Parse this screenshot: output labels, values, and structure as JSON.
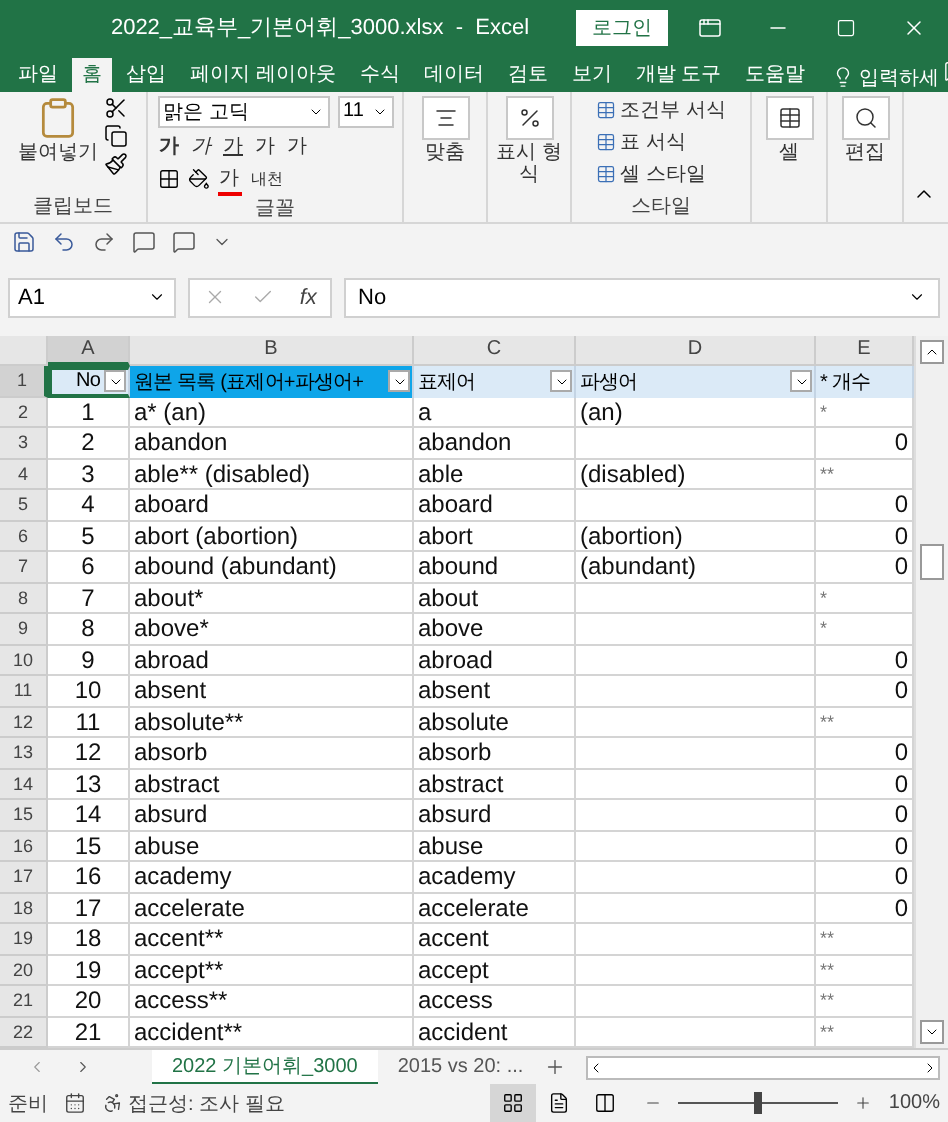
{
  "window": {
    "title": "2022_교육부_기본어휘_3000.xlsx  -  Excel",
    "login_button": "로그인"
  },
  "ribbon_tabs": [
    {
      "label": "파일",
      "selected": false
    },
    {
      "label": "홈",
      "selected": true
    },
    {
      "label": "삽입",
      "selected": false
    },
    {
      "label": "페이지 레이아웃",
      "selected": false
    },
    {
      "label": "수식",
      "selected": false
    },
    {
      "label": "데이터",
      "selected": false
    },
    {
      "label": "검토",
      "selected": false
    },
    {
      "label": "보기",
      "selected": false
    },
    {
      "label": "개발 도구",
      "selected": false
    },
    {
      "label": "도움말",
      "selected": false
    }
  ],
  "tell_me": "입력하세",
  "ribbon": {
    "paste": "붙여넣기",
    "clipboard_group": "클립보드",
    "font_name": "맑은 고딕",
    "font_size": "11",
    "style_buttons": [
      "가",
      "가",
      "가"
    ],
    "size_buttons": [
      "가",
      "가"
    ],
    "font_color": "가",
    "phonetic": "내천",
    "font_group": "글꼴",
    "alignment": "맞춤",
    "number_format": "표시 형식",
    "styles": [
      "조건부 서식",
      "표 서식",
      "셀 스타일"
    ],
    "styles_group": "스타일",
    "cells": "셀",
    "editing": "편집"
  },
  "formula_bar": {
    "name_box": "A1",
    "fx": "fx",
    "value": "No"
  },
  "columns": [
    {
      "letter": "A",
      "selected": true
    },
    {
      "letter": "B",
      "selected": false
    },
    {
      "letter": "C",
      "selected": false
    },
    {
      "letter": "D",
      "selected": false
    },
    {
      "letter": "E",
      "selected": false
    }
  ],
  "header_row": {
    "row": "1",
    "selected": true,
    "cells": [
      {
        "text": "No",
        "highlighted": false,
        "active": true
      },
      {
        "text": "원본 목록 (표제어+파생어+",
        "highlighted": true,
        "active": false
      },
      {
        "text": "표제어",
        "highlighted": false,
        "active": false
      },
      {
        "text": "파생어",
        "highlighted": false,
        "active": false
      },
      {
        "text": "* 개수",
        "highlighted": false,
        "active": false
      }
    ]
  },
  "rows": [
    {
      "row": "2",
      "selected": false,
      "no": "1",
      "entry": "a* (an)",
      "headword": "a",
      "derived": "(an)",
      "count": "*",
      "numeric": false
    },
    {
      "row": "3",
      "selected": false,
      "no": "2",
      "entry": "abandon",
      "headword": "abandon",
      "count": "0",
      "numeric": true
    },
    {
      "row": "4",
      "selected": false,
      "no": "3",
      "entry": "able** (disabled)",
      "headword": "able",
      "derived": "(disabled)",
      "count": "**",
      "numeric": false
    },
    {
      "row": "5",
      "selected": false,
      "no": "4",
      "entry": "aboard",
      "headword": "aboard",
      "count": "0",
      "numeric": true
    },
    {
      "row": "6",
      "selected": false,
      "no": "5",
      "entry": "abort (abortion)",
      "headword": "abort",
      "derived": "(abortion)",
      "count": "0",
      "numeric": true
    },
    {
      "row": "7",
      "selected": false,
      "no": "6",
      "entry": "abound (abundant)",
      "headword": "abound",
      "derived": "(abundant)",
      "count": "0",
      "numeric": true
    },
    {
      "row": "8",
      "selected": false,
      "no": "7",
      "entry": "about*",
      "headword": "about",
      "count": "*",
      "numeric": false
    },
    {
      "row": "9",
      "selected": false,
      "no": "8",
      "entry": "above*",
      "headword": "above",
      "count": "*",
      "numeric": false
    },
    {
      "row": "10",
      "selected": false,
      "no": "9",
      "entry": "abroad",
      "headword": "abroad",
      "count": "0",
      "numeric": true
    },
    {
      "row": "11",
      "selected": false,
      "no": "10",
      "entry": "absent",
      "headword": "absent",
      "count": "0",
      "numeric": true
    },
    {
      "row": "12",
      "selected": false,
      "no": "11",
      "entry": "absolute**",
      "headword": "absolute",
      "count": "**",
      "numeric": false
    },
    {
      "row": "13",
      "selected": false,
      "no": "12",
      "entry": "absorb",
      "headword": "absorb",
      "count": "0",
      "numeric": true
    },
    {
      "row": "14",
      "selected": false,
      "no": "13",
      "entry": "abstract",
      "headword": "abstract",
      "count": "0",
      "numeric": true
    },
    {
      "row": "15",
      "selected": false,
      "no": "14",
      "entry": "absurd",
      "headword": "absurd",
      "count": "0",
      "numeric": true
    },
    {
      "row": "16",
      "selected": false,
      "no": "15",
      "entry": "abuse",
      "headword": "abuse",
      "count": "0",
      "numeric": true
    },
    {
      "row": "17",
      "selected": false,
      "no": "16",
      "entry": "academy",
      "headword": "academy",
      "count": "0",
      "numeric": true
    },
    {
      "row": "18",
      "selected": false,
      "no": "17",
      "entry": "accelerate",
      "headword": "accelerate",
      "count": "0",
      "numeric": true
    },
    {
      "row": "19",
      "selected": false,
      "no": "18",
      "entry": "accent**",
      "headword": "accent",
      "count": "**",
      "numeric": false
    },
    {
      "row": "20",
      "selected": false,
      "no": "19",
      "entry": "accept**",
      "headword": "accept",
      "count": "**",
      "numeric": false
    },
    {
      "row": "21",
      "selected": false,
      "no": "20",
      "entry": "access**",
      "headword": "access",
      "count": "**",
      "numeric": false
    },
    {
      "row": "22",
      "selected": false,
      "no": "21",
      "entry": "accident**",
      "headword": "accident",
      "count": "**",
      "numeric": false
    }
  ],
  "sheet_tabs": [
    {
      "label": "2022 기본어휘_3000",
      "selected": true
    },
    {
      "label": "2015 vs 20: ...",
      "selected": false
    }
  ],
  "status_bar": {
    "ready": "준비",
    "accessibility": "접근성: 조사 필요",
    "views": [
      {
        "kind": "normal",
        "selected": true
      },
      {
        "kind": "layout",
        "selected": false
      },
      {
        "kind": "break",
        "selected": false
      }
    ],
    "zoom": {
      "level": 0.5,
      "reading": "100%"
    }
  }
}
